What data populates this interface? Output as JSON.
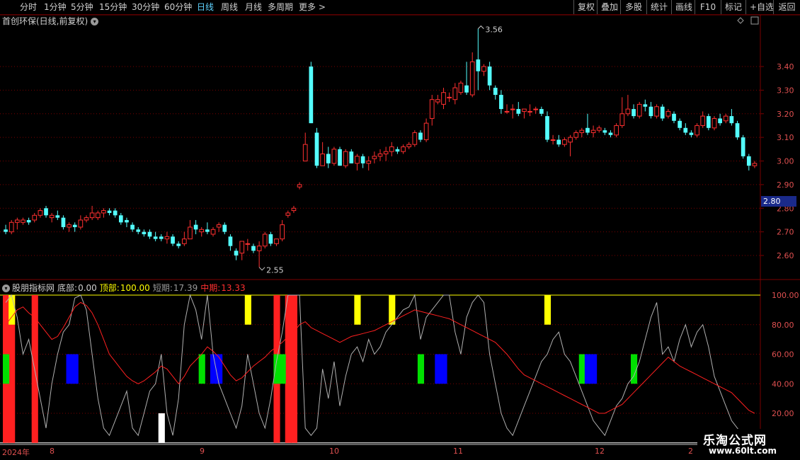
{
  "toolbar": {
    "periods": [
      "分时",
      "1分钟",
      "5分钟",
      "15分钟",
      "30分钟",
      "60分钟",
      "日线",
      "周线",
      "月线",
      "多周期",
      "更多 >"
    ],
    "active": "日线",
    "right_buttons": [
      "复权",
      "叠加",
      "多股",
      "统计",
      "画线",
      "F10",
      "标记",
      "+自选",
      "返回"
    ]
  },
  "main": {
    "title": "首创环保(日线,前复权)",
    "price_ticks": [
      "3.40",
      "3.30",
      "3.20",
      "3.10",
      "3.00",
      "2.90",
      "2.80",
      "2.70",
      "2.60"
    ],
    "price_ticks_values": [
      3.4,
      3.3,
      3.2,
      3.1,
      3.0,
      2.9,
      2.8,
      2.7,
      2.6
    ],
    "current_price": "2.80",
    "high_label": "3.56",
    "low_label": "2.55"
  },
  "indicator": {
    "name": "股朋指标网",
    "bottom_label": "底部:",
    "bottom_value": "0.00",
    "top_label": "顶部:",
    "top_value": "100.00",
    "short_label": "短期:",
    "short_value": "17.39",
    "mid_label": "中期:",
    "mid_value": "13.33",
    "ticks": [
      "100.00",
      "80.00",
      "60.00",
      "40.00",
      "20.00"
    ],
    "tick_values": [
      100,
      80,
      60,
      40,
      20
    ]
  },
  "dates": {
    "year": "2024年",
    "months": [
      "8",
      "9",
      "10",
      "11",
      "12"
    ],
    "last": "2"
  },
  "watermark": {
    "title": "乐淘公式网",
    "url": "www.60lt.com"
  },
  "colors": {
    "up": "#ff3030",
    "down": "#54ffff",
    "bg": "#000000",
    "grid": "#7a0000",
    "green": "#00e000",
    "blue": "#0000ff",
    "yellow": "#ffff00",
    "white": "#ffffff"
  },
  "chart_data": {
    "type": "candlestick",
    "ohlc": [
      [
        2.71,
        2.73,
        2.69,
        2.7
      ],
      [
        2.7,
        2.75,
        2.69,
        2.74
      ],
      [
        2.74,
        2.76,
        2.71,
        2.75
      ],
      [
        2.74,
        2.76,
        2.73,
        2.75
      ],
      [
        2.75,
        2.76,
        2.73,
        2.74
      ],
      [
        2.75,
        2.78,
        2.74,
        2.77
      ],
      [
        2.77,
        2.8,
        2.76,
        2.79
      ],
      [
        2.8,
        2.81,
        2.76,
        2.77
      ],
      [
        2.76,
        2.78,
        2.74,
        2.77
      ],
      [
        2.77,
        2.79,
        2.75,
        2.76
      ],
      [
        2.76,
        2.77,
        2.71,
        2.72
      ],
      [
        2.72,
        2.74,
        2.7,
        2.73
      ],
      [
        2.73,
        2.74,
        2.7,
        2.72
      ],
      [
        2.72,
        2.77,
        2.71,
        2.75
      ],
      [
        2.75,
        2.77,
        2.74,
        2.76
      ],
      [
        2.76,
        2.81,
        2.75,
        2.78
      ],
      [
        2.76,
        2.79,
        2.75,
        2.78
      ],
      [
        2.78,
        2.8,
        2.76,
        2.79
      ],
      [
        2.79,
        2.8,
        2.77,
        2.78
      ],
      [
        2.79,
        2.8,
        2.76,
        2.77
      ],
      [
        2.77,
        2.78,
        2.73,
        2.74
      ],
      [
        2.75,
        2.76,
        2.72,
        2.74
      ],
      [
        2.73,
        2.74,
        2.7,
        2.71
      ],
      [
        2.71,
        2.72,
        2.69,
        2.7
      ],
      [
        2.7,
        2.71,
        2.68,
        2.69
      ],
      [
        2.7,
        2.71,
        2.67,
        2.68
      ],
      [
        2.68,
        2.7,
        2.66,
        2.67
      ],
      [
        2.68,
        2.69,
        2.66,
        2.67
      ],
      [
        2.67,
        2.7,
        2.65,
        2.68
      ],
      [
        2.68,
        2.69,
        2.64,
        2.65
      ],
      [
        2.65,
        2.66,
        2.63,
        2.64
      ],
      [
        2.65,
        2.7,
        2.64,
        2.67
      ],
      [
        2.67,
        2.75,
        2.67,
        2.72
      ],
      [
        2.73,
        2.75,
        2.69,
        2.71
      ],
      [
        2.7,
        2.72,
        2.68,
        2.71
      ],
      [
        2.71,
        2.74,
        2.69,
        2.7
      ],
      [
        2.69,
        2.72,
        2.68,
        2.71
      ],
      [
        2.72,
        2.74,
        2.7,
        2.73
      ],
      [
        2.73,
        2.74,
        2.69,
        2.7
      ],
      [
        2.68,
        2.69,
        2.62,
        2.64
      ],
      [
        2.62,
        2.63,
        2.58,
        2.6
      ],
      [
        2.61,
        2.64,
        2.58,
        2.66
      ],
      [
        2.65,
        2.67,
        2.62,
        2.65
      ],
      [
        2.64,
        2.65,
        2.61,
        2.62
      ],
      [
        2.62,
        2.66,
        2.55,
        2.64
      ],
      [
        2.64,
        2.7,
        2.63,
        2.69
      ],
      [
        2.69,
        2.7,
        2.64,
        2.65
      ],
      [
        2.65,
        2.67,
        2.64,
        2.67
      ],
      [
        2.67,
        2.75,
        2.66,
        2.73
      ],
      [
        2.77,
        2.79,
        2.76,
        2.78
      ],
      [
        2.79,
        2.81,
        2.78,
        2.8
      ],
      [
        2.89,
        2.91,
        2.88,
        2.9
      ],
      [
        3.0,
        3.12,
        3.0,
        3.07
      ],
      [
        3.4,
        3.42,
        3.16,
        3.16
      ],
      [
        3.12,
        3.14,
        2.97,
        2.98
      ],
      [
        2.98,
        3.08,
        2.98,
        3.03
      ],
      [
        3.03,
        3.06,
        2.97,
        2.99
      ],
      [
        2.99,
        3.06,
        2.98,
        3.05
      ],
      [
        3.05,
        3.06,
        2.98,
        2.98
      ],
      [
        2.98,
        3.05,
        2.97,
        3.04
      ],
      [
        3.04,
        3.05,
        2.99,
        2.99
      ],
      [
        2.99,
        3.03,
        2.96,
        3.02
      ],
      [
        3.02,
        3.03,
        2.97,
        2.99
      ],
      [
        2.99,
        3.02,
        2.96,
        3.0
      ],
      [
        3.01,
        3.04,
        2.99,
        3.02
      ],
      [
        3.02,
        3.05,
        3.0,
        3.03
      ],
      [
        3.03,
        3.06,
        3.0,
        3.04
      ],
      [
        3.04,
        3.08,
        3.02,
        3.06
      ],
      [
        3.05,
        3.06,
        3.03,
        3.04
      ],
      [
        3.04,
        3.07,
        3.03,
        3.06
      ],
      [
        3.06,
        3.08,
        3.05,
        3.07
      ],
      [
        3.07,
        3.13,
        3.06,
        3.12
      ],
      [
        3.12,
        3.13,
        3.08,
        3.09
      ],
      [
        3.09,
        3.18,
        3.08,
        3.16
      ],
      [
        3.18,
        3.28,
        3.15,
        3.26
      ],
      [
        3.25,
        3.28,
        3.24,
        3.26
      ],
      [
        3.24,
        3.31,
        3.22,
        3.29
      ],
      [
        3.27,
        3.29,
        3.25,
        3.27
      ],
      [
        3.26,
        3.33,
        3.24,
        3.31
      ],
      [
        3.29,
        3.34,
        3.28,
        3.33
      ],
      [
        3.32,
        3.42,
        3.28,
        3.29
      ],
      [
        3.28,
        3.46,
        3.27,
        3.42
      ],
      [
        3.43,
        3.56,
        3.3,
        3.38
      ],
      [
        3.38,
        3.41,
        3.36,
        3.4
      ],
      [
        3.4,
        3.42,
        3.3,
        3.32
      ],
      [
        3.31,
        3.32,
        3.26,
        3.28
      ],
      [
        3.28,
        3.3,
        3.2,
        3.22
      ],
      [
        3.21,
        3.24,
        3.2,
        3.21
      ],
      [
        3.22,
        3.24,
        3.18,
        3.22
      ],
      [
        3.22,
        3.25,
        3.19,
        3.2
      ],
      [
        3.21,
        3.22,
        3.18,
        3.22
      ],
      [
        3.21,
        3.24,
        3.19,
        3.21
      ],
      [
        3.22,
        3.23,
        3.2,
        3.22
      ],
      [
        3.22,
        3.23,
        3.19,
        3.2
      ],
      [
        3.19,
        3.21,
        3.08,
        3.09
      ],
      [
        3.09,
        3.11,
        3.07,
        3.09
      ],
      [
        3.09,
        3.11,
        3.06,
        3.07
      ],
      [
        3.07,
        3.1,
        3.06,
        3.09
      ],
      [
        3.08,
        3.11,
        3.02,
        3.1
      ],
      [
        3.1,
        3.13,
        3.09,
        3.12
      ],
      [
        3.12,
        3.14,
        3.1,
        3.13
      ],
      [
        3.14,
        3.2,
        3.11,
        3.12
      ],
      [
        3.12,
        3.15,
        3.1,
        3.13
      ],
      [
        3.13,
        3.15,
        3.12,
        3.14
      ],
      [
        3.13,
        3.14,
        3.11,
        3.12
      ],
      [
        3.12,
        3.13,
        3.1,
        3.11
      ],
      [
        3.11,
        3.16,
        3.1,
        3.15
      ],
      [
        3.15,
        3.27,
        3.14,
        3.2
      ],
      [
        3.2,
        3.28,
        3.19,
        3.22
      ],
      [
        3.22,
        3.24,
        3.18,
        3.19
      ],
      [
        3.19,
        3.25,
        3.18,
        3.24
      ],
      [
        3.24,
        3.26,
        3.21,
        3.23
      ],
      [
        3.23,
        3.25,
        3.18,
        3.19
      ],
      [
        3.19,
        3.24,
        3.18,
        3.23
      ],
      [
        3.23,
        3.24,
        3.17,
        3.18
      ],
      [
        3.19,
        3.22,
        3.18,
        3.21
      ],
      [
        3.2,
        3.21,
        3.16,
        3.17
      ],
      [
        3.17,
        3.18,
        3.13,
        3.14
      ],
      [
        3.14,
        3.16,
        3.11,
        3.12
      ],
      [
        3.12,
        3.13,
        3.1,
        3.11
      ],
      [
        3.11,
        3.16,
        3.1,
        3.15
      ],
      [
        3.15,
        3.21,
        3.14,
        3.19
      ],
      [
        3.19,
        3.2,
        3.13,
        3.14
      ],
      [
        3.14,
        3.19,
        3.13,
        3.18
      ],
      [
        3.18,
        3.2,
        3.15,
        3.16
      ],
      [
        3.17,
        3.2,
        3.16,
        3.19
      ],
      [
        3.19,
        3.22,
        3.15,
        3.16
      ],
      [
        3.16,
        3.17,
        3.09,
        3.1
      ],
      [
        3.1,
        3.11,
        3.01,
        3.02
      ],
      [
        3.02,
        3.03,
        2.96,
        2.98
      ],
      [
        2.98,
        3.0,
        2.97,
        2.99
      ]
    ],
    "ind_short": [
      95,
      100,
      85,
      60,
      70,
      50,
      30,
      10,
      40,
      60,
      75,
      80,
      98,
      100,
      90,
      60,
      30,
      10,
      5,
      15,
      25,
      35,
      10,
      5,
      20,
      35,
      40,
      60,
      20,
      5,
      30,
      80,
      100,
      90,
      70,
      100,
      60,
      40,
      30,
      20,
      10,
      25,
      60,
      40,
      20,
      10,
      30,
      55,
      75,
      100,
      100,
      100,
      10,
      5,
      10,
      50,
      30,
      55,
      25,
      45,
      60,
      65,
      55,
      70,
      60,
      65,
      75,
      80,
      85,
      90,
      92,
      100,
      70,
      85,
      90,
      95,
      100,
      100,
      75,
      60,
      85,
      95,
      100,
      95,
      60,
      40,
      20,
      10,
      5,
      15,
      25,
      35,
      45,
      55,
      60,
      70,
      75,
      60,
      55,
      45,
      35,
      25,
      15,
      10,
      5,
      15,
      25,
      30,
      40,
      45,
      55,
      70,
      85,
      95,
      60,
      65,
      55,
      70,
      80,
      65,
      75,
      80,
      65,
      45,
      35,
      25,
      15,
      10,
      5,
      0,
      5,
      15,
      17.39
    ],
    "ind_mid": [
      80,
      85,
      90,
      92,
      88,
      85,
      80,
      75,
      70,
      72,
      78,
      85,
      92,
      95,
      93,
      88,
      80,
      70,
      60,
      55,
      50,
      45,
      42,
      40,
      42,
      45,
      48,
      52,
      50,
      45,
      40,
      45,
      52,
      56,
      60,
      65,
      62,
      58,
      52,
      46,
      42,
      44,
      48,
      52,
      55,
      58,
      62,
      65,
      68,
      72,
      75,
      80,
      82,
      78,
      76,
      74,
      72,
      70,
      68,
      70,
      72,
      73,
      74,
      75,
      76,
      78,
      80,
      82,
      84,
      86,
      88,
      90,
      89,
      88,
      87,
      86,
      85,
      84,
      82,
      80,
      78,
      76,
      74,
      72,
      70,
      68,
      64,
      60,
      55,
      50,
      46,
      44,
      42,
      40,
      38,
      36,
      34,
      32,
      30,
      28,
      26,
      24,
      22,
      20,
      20,
      22,
      24,
      26,
      30,
      34,
      38,
      42,
      46,
      50,
      54,
      58,
      55,
      52,
      50,
      48,
      46,
      44,
      42,
      40,
      38,
      36,
      34,
      30,
      26,
      22,
      20,
      18,
      15,
      13.33
    ],
    "bars": [
      {
        "type": "red",
        "x": [
          0,
          1,
          5,
          47,
          49,
          50
        ]
      },
      {
        "type": "yellow",
        "x": [
          1,
          42,
          61,
          67,
          94
        ]
      },
      {
        "type": "green",
        "x": [
          0,
          34,
          47,
          48,
          72,
          100,
          109
        ]
      },
      {
        "type": "blue",
        "x": [
          11,
          12,
          36,
          37,
          75,
          76,
          101,
          102
        ]
      },
      {
        "type": "white",
        "x": [
          27
        ]
      }
    ]
  }
}
